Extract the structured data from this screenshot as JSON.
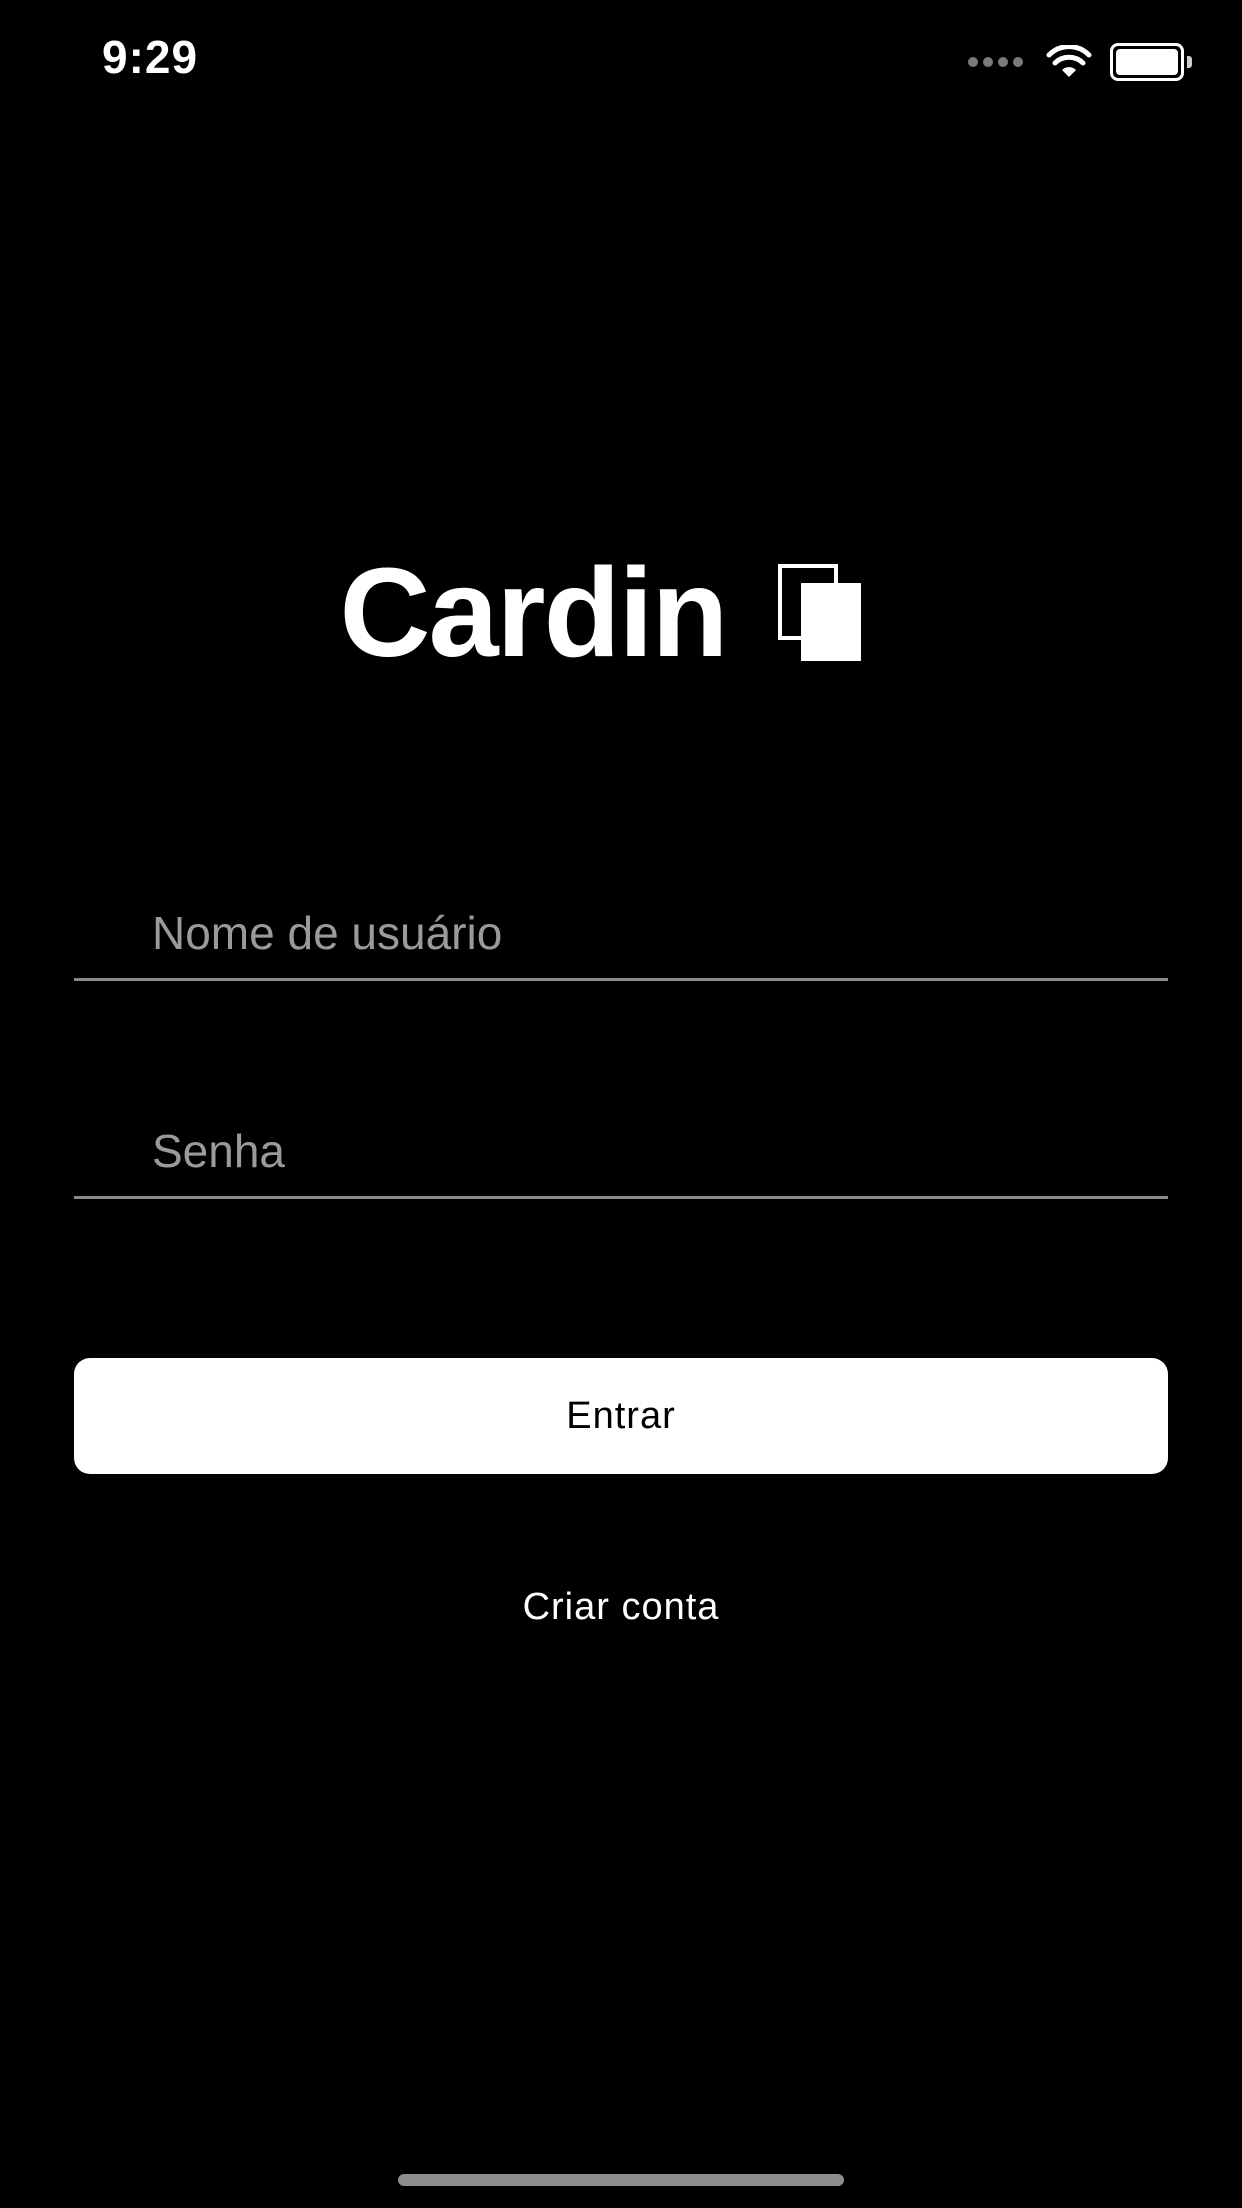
{
  "status_bar": {
    "time": "9:29",
    "icons": [
      "cellular-signal-icon",
      "wifi-icon",
      "battery-icon"
    ]
  },
  "logo": {
    "text": "Cardin",
    "mark_icon": "stacked-cards-icon"
  },
  "form": {
    "username_placeholder": "Nome de usuário",
    "username_value": "",
    "password_placeholder": "Senha",
    "password_value": ""
  },
  "actions": {
    "login_label": "Entrar",
    "create_account_label": "Criar conta"
  },
  "colors": {
    "background": "#000000",
    "foreground": "#ffffff",
    "placeholder": "#9a9a9a",
    "divider": "#8a8a8a"
  }
}
